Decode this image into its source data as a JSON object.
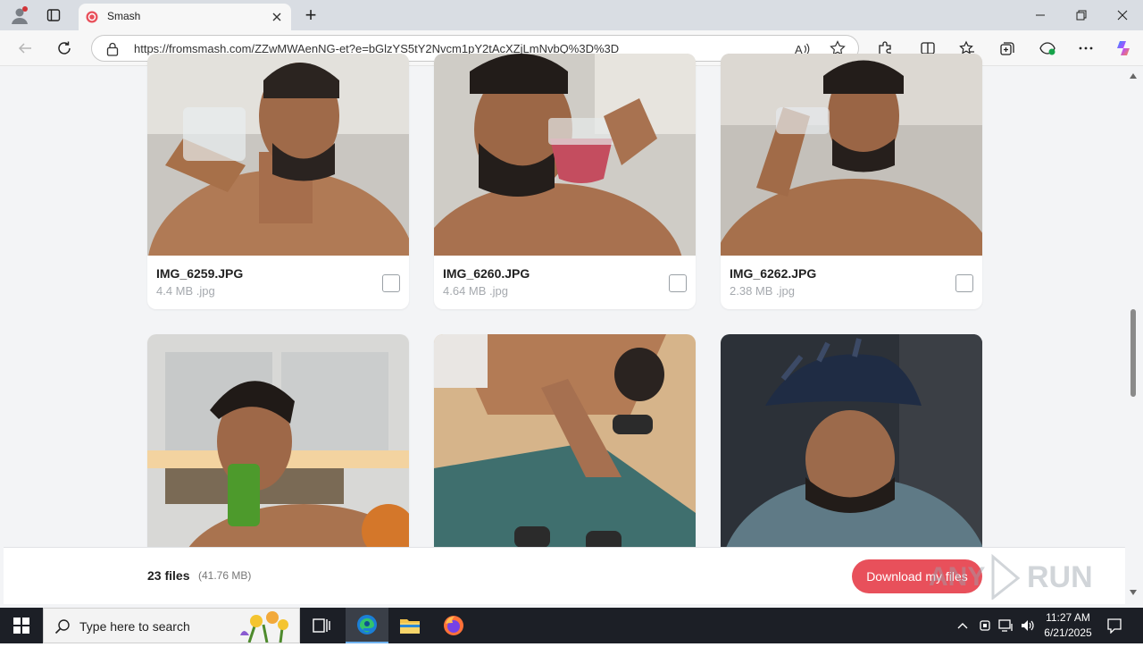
{
  "browser": {
    "tab_title": "Smash",
    "url": "https://fromsmash.com/ZZwMWAenNG-et?e=bGlzYS5tY2Nvcm1pY2tAcXZjLmNvbQ%3D%3D",
    "new_tab_symbol": "+"
  },
  "files": [
    {
      "name": "IMG_6259.JPG",
      "meta": "4.4 MB .jpg"
    },
    {
      "name": "IMG_6260.JPG",
      "meta": "4.64 MB .jpg"
    },
    {
      "name": "IMG_6262.JPG",
      "meta": "2.38 MB .jpg"
    }
  ],
  "footer": {
    "count_label": "23 files",
    "size_label": "(41.76 MB)",
    "download_label": "Download my files"
  },
  "watermark": "ANY RUN",
  "taskbar": {
    "search_placeholder": "Type here to search",
    "time": "11:27 AM",
    "date": "6/21/2025"
  },
  "colors": {
    "accent": "#e8505b",
    "taskbar": "#1c1f26"
  }
}
